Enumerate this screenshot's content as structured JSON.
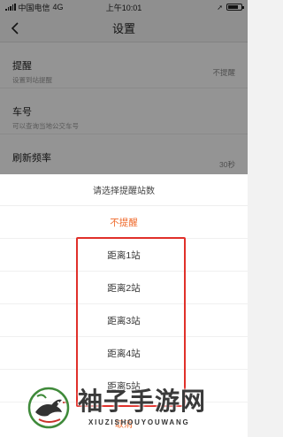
{
  "status_bar": {
    "carrier": "中国电信",
    "network": "4G",
    "time": "上午10:01"
  },
  "nav": {
    "title": "设置"
  },
  "settings": [
    {
      "title": "提醒",
      "subtitle": "设置到站提醒",
      "value": "不提醒"
    },
    {
      "title": "车号",
      "subtitle": "可以查询当地公交车号",
      "value": ""
    },
    {
      "title": "刷新频率",
      "subtitle": "",
      "value": "30秒"
    }
  ],
  "sheet": {
    "header": "请选择提醒站数",
    "options": [
      {
        "label": "不提醒",
        "selected": true
      },
      {
        "label": "距离1站",
        "selected": false
      },
      {
        "label": "距离2站",
        "selected": false
      },
      {
        "label": "距离3站",
        "selected": false
      },
      {
        "label": "距离4站",
        "selected": false
      },
      {
        "label": "距离5站",
        "selected": false
      }
    ],
    "cancel": "取消"
  },
  "watermark": {
    "title": "袖子手游网",
    "subtitle": "XIUZISHOUYOUWANG"
  },
  "colors": {
    "accent": "#ef6a2b",
    "highlight": "#e0302a"
  }
}
